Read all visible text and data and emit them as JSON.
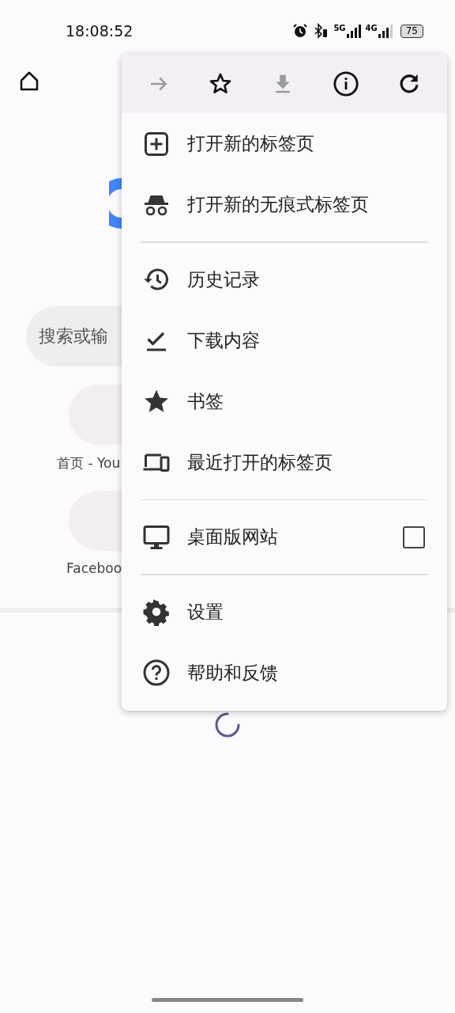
{
  "status_bar": {
    "time": "18:08:52",
    "network_1": "5G",
    "network_2": "4G",
    "battery": "75"
  },
  "page": {
    "search": {
      "placeholder": "搜索或输"
    },
    "shortcuts": [
      {
        "label": "首页 - You"
      },
      {
        "label": "Faceboo"
      }
    ]
  },
  "menu": {
    "toolbar": [
      {
        "kind": "forward",
        "disabled": true
      },
      {
        "kind": "star",
        "disabled": false
      },
      {
        "kind": "download",
        "disabled": true
      },
      {
        "kind": "info",
        "disabled": false
      },
      {
        "kind": "refresh",
        "disabled": false
      }
    ],
    "sections": [
      {
        "items": [
          {
            "kind": "link",
            "label": "打开新的标签页"
          },
          {
            "kind": "link",
            "label": "打开新的无痕式标签页"
          }
        ]
      },
      {
        "items": [
          {
            "kind": "link",
            "label": "历史记录"
          },
          {
            "kind": "link",
            "label": "下载内容"
          },
          {
            "kind": "link",
            "label": "书签"
          },
          {
            "kind": "link",
            "label": "最近打开的标签页"
          }
        ]
      },
      {
        "items": [
          {
            "kind": "checkbox",
            "label": "桌面版网站",
            "checked": false
          }
        ]
      },
      {
        "items": [
          {
            "kind": "link",
            "label": "设置"
          },
          {
            "kind": "link",
            "label": "帮助和反馈"
          }
        ]
      }
    ]
  }
}
